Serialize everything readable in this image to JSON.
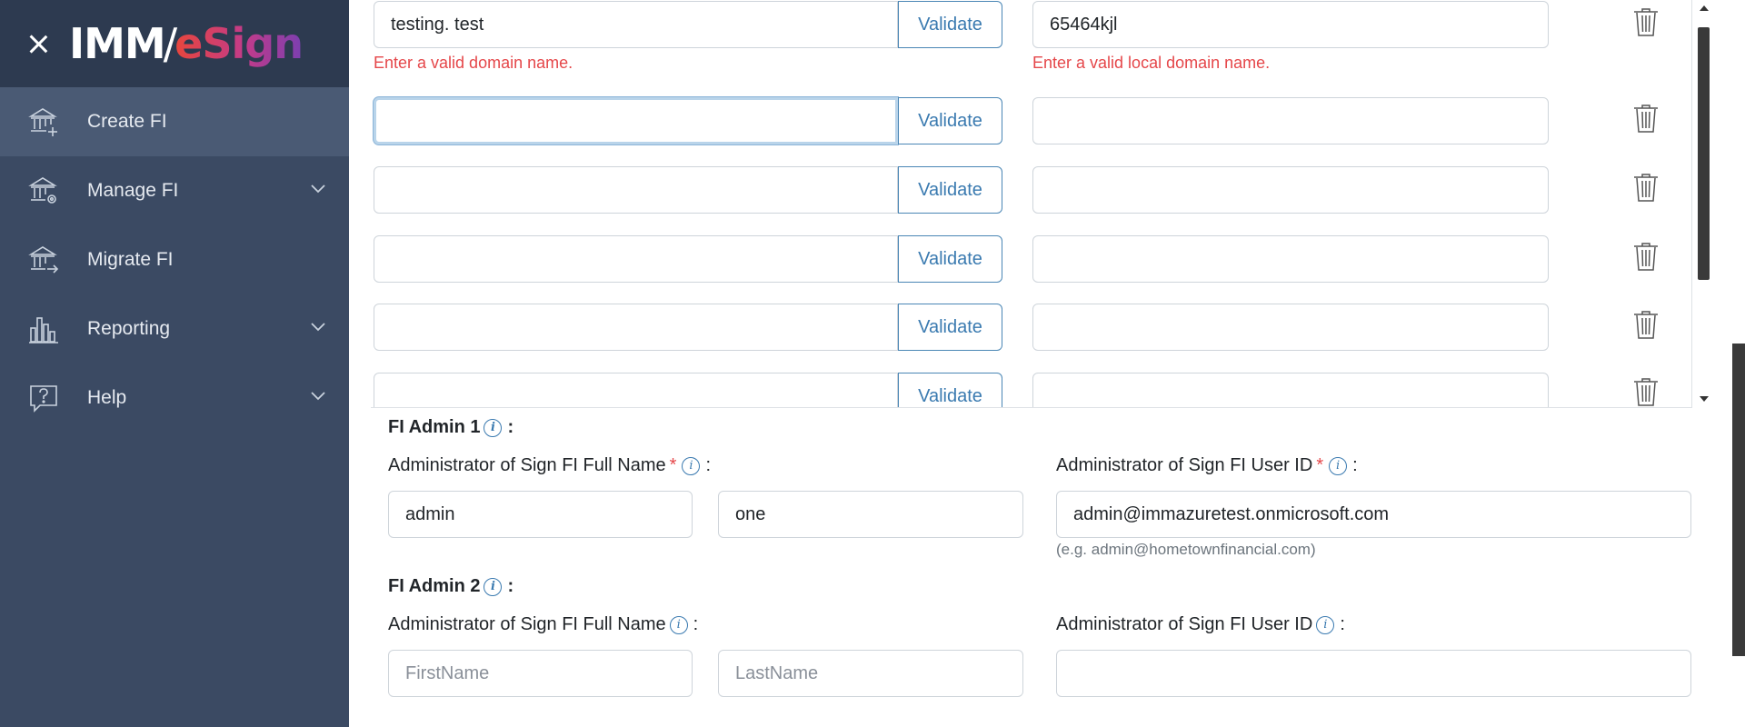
{
  "sidebar": {
    "logo_prefix": "IMM",
    "logo_slash": "/",
    "logo_suffix": "eSign",
    "items": [
      {
        "label": "Create FI",
        "icon": "bank-plus-icon"
      },
      {
        "label": "Manage FI",
        "icon": "bank-gear-icon"
      },
      {
        "label": "Migrate FI",
        "icon": "bank-arrow-icon"
      },
      {
        "label": "Reporting",
        "icon": "bar-chart-icon"
      },
      {
        "label": "Help",
        "icon": "help-bubble-icon"
      }
    ]
  },
  "domains": {
    "validate_label": "Validate",
    "rows": [
      {
        "domain": "testing. test",
        "local": "65464kjl",
        "domain_error": "Enter a valid domain name.",
        "local_error": "Enter a valid local domain name."
      },
      {
        "domain": "",
        "local": ""
      },
      {
        "domain": "",
        "local": ""
      },
      {
        "domain": "",
        "local": ""
      },
      {
        "domain": "",
        "local": ""
      },
      {
        "domain": "",
        "local": ""
      }
    ]
  },
  "admin1": {
    "title": "FI Admin 1",
    "full_name_label": "Administrator of Sign FI Full Name",
    "user_id_label": "Administrator of Sign FI User ID",
    "first_name": "admin",
    "last_name": "one",
    "user_id": "admin@immazuretest.onmicrosoft.com",
    "user_id_hint": "(e.g. admin@hometownfinancial.com)"
  },
  "admin2": {
    "title": "FI Admin 2",
    "full_name_label": "Administrator of Sign FI Full Name",
    "user_id_label": "Administrator of Sign FI User ID",
    "first_name_placeholder": "FirstName",
    "last_name_placeholder": "LastName",
    "user_id": ""
  },
  "common": {
    "colon": ":",
    "required_mark": "*",
    "info_glyph": "i"
  }
}
